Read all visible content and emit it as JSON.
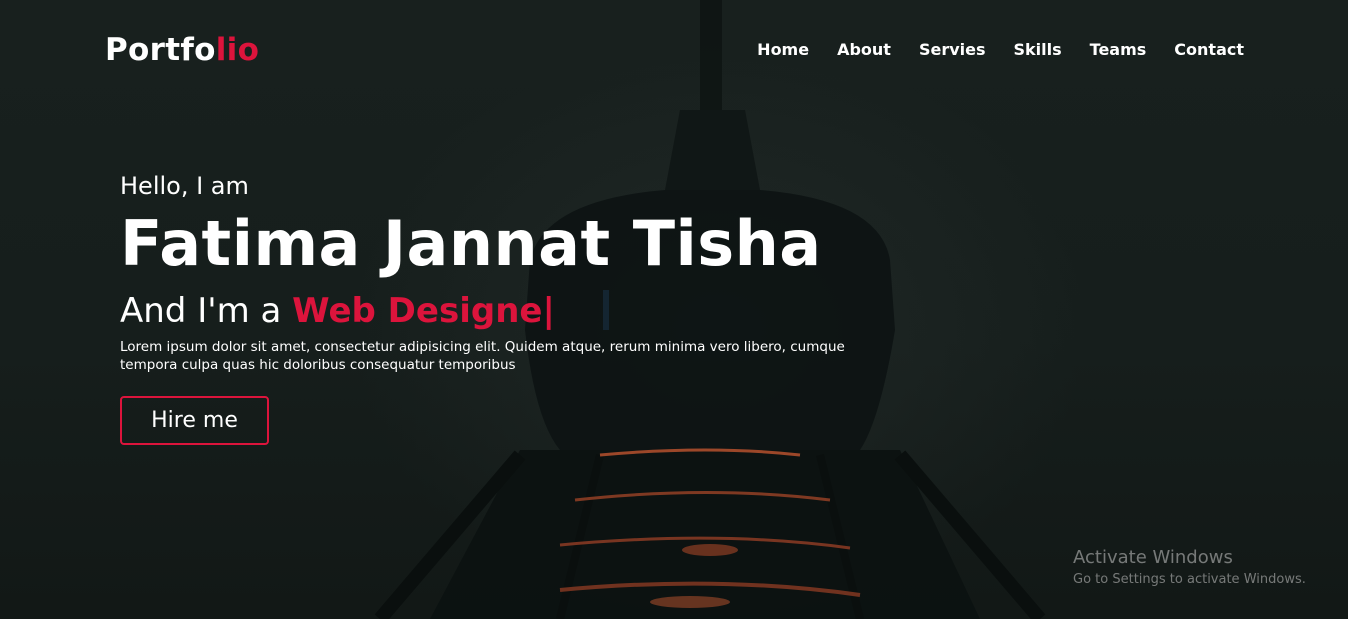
{
  "navbar": {
    "logo_main": "Portfo",
    "logo_accent": "lio",
    "links": [
      "Home",
      "About",
      "Servies",
      "Skills",
      "Teams",
      "Contact"
    ]
  },
  "hero": {
    "greeting": "Hello, I am",
    "name": "Fatima Jannat Tisha",
    "role_prefix": "And I'm a",
    "role_typed": "Web Designe",
    "role_cursor": "|",
    "description": "Lorem ipsum dolor sit amet, consectetur adipisicing elit. Quidem atque, rerum minima vero libero, cumque tempora culpa quas hic doloribus consequatur temporibus",
    "button_label": "Hire me"
  },
  "watermark": {
    "title": "Activate Windows",
    "subtitle": "Go to Settings to activate Windows."
  },
  "colors": {
    "accent": "#dc143c",
    "background": "#161e1c",
    "text": "#ffffff"
  }
}
